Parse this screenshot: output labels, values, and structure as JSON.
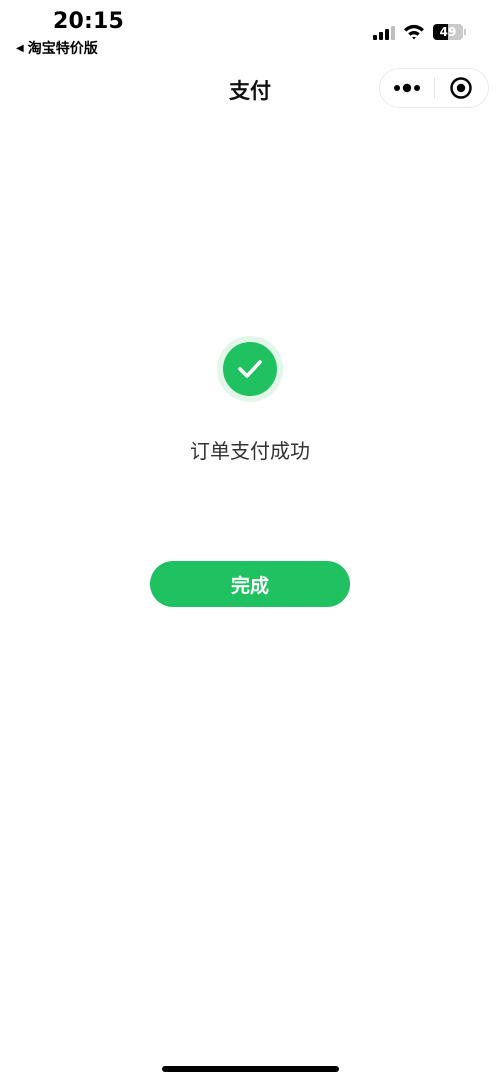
{
  "status_bar": {
    "time": "20:15",
    "back_app": "淘宝特价版",
    "battery_level": "49"
  },
  "nav": {
    "title": "支付"
  },
  "result": {
    "message": "订单支付成功",
    "done_label": "完成"
  },
  "colors": {
    "accent": "#1fc160",
    "accent_light": "#e2f6e9"
  },
  "icons": {
    "back_arrow": "triangle-left-icon",
    "menu": "more-dots-icon",
    "close": "target-close-icon",
    "success": "check-icon"
  }
}
